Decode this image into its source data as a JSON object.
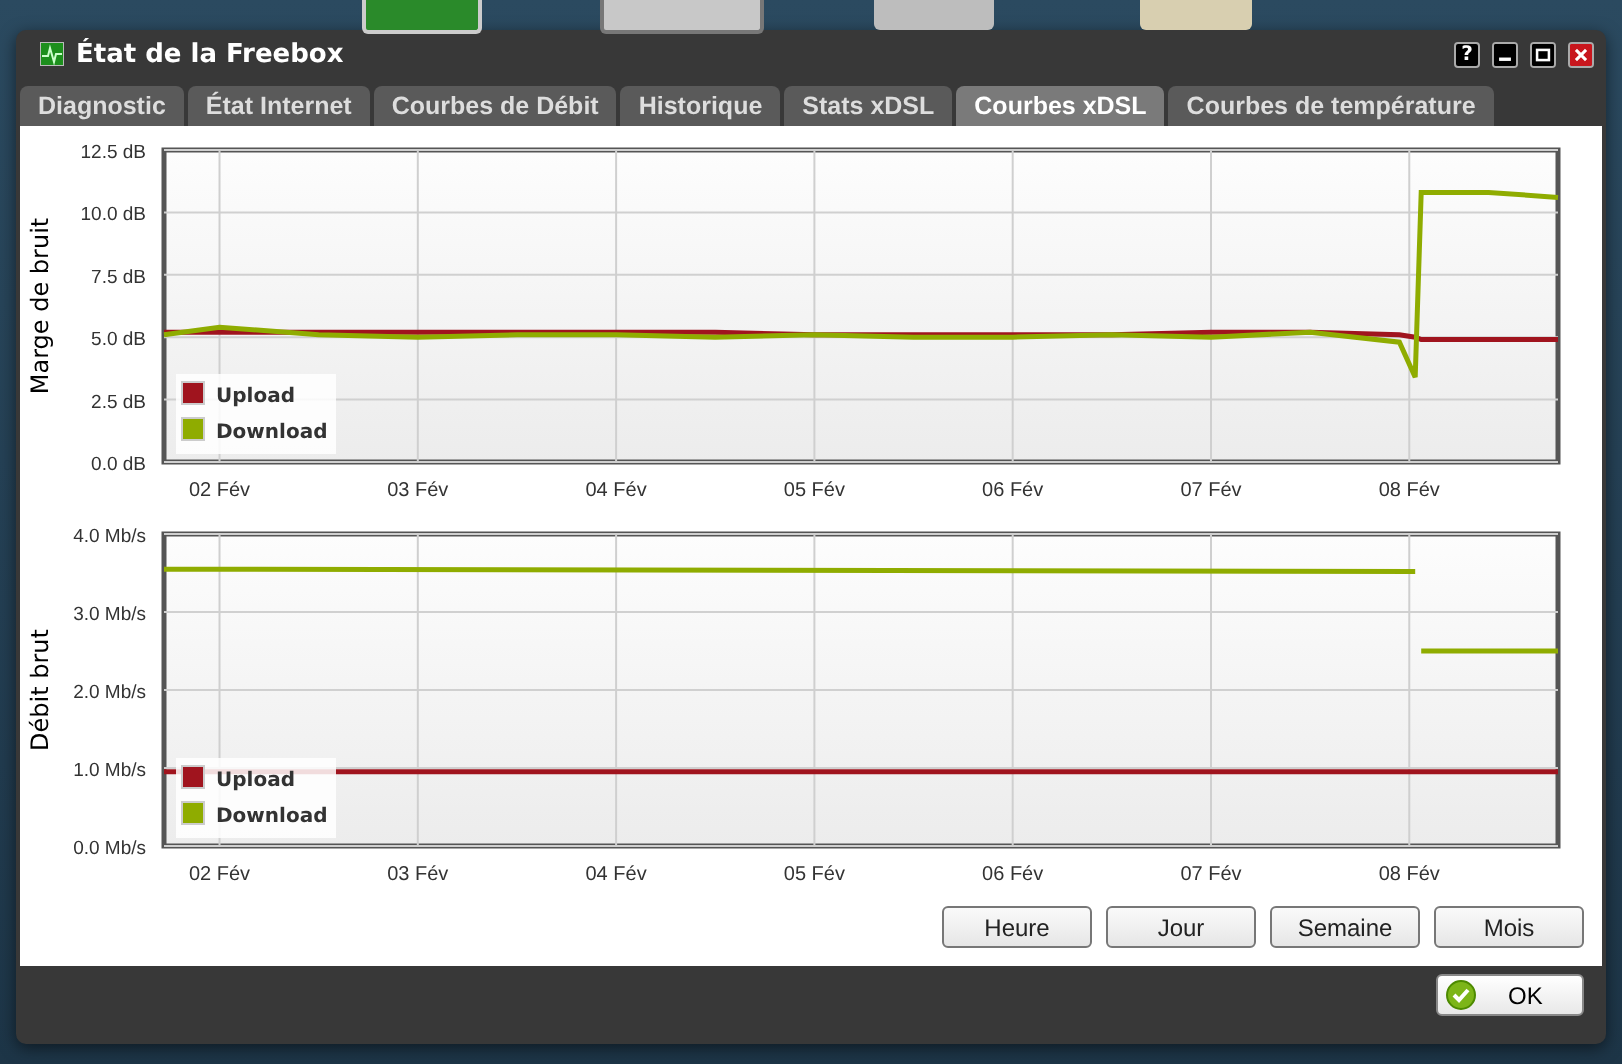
{
  "window": {
    "title": "État de la Freebox",
    "help_label": "?"
  },
  "tabs": [
    {
      "label": "Diagnostic",
      "selected": false
    },
    {
      "label": "État Internet",
      "selected": false
    },
    {
      "label": "Courbes de Débit",
      "selected": false
    },
    {
      "label": "Historique",
      "selected": false
    },
    {
      "label": "Stats xDSL",
      "selected": false
    },
    {
      "label": "Courbes xDSL",
      "selected": true
    },
    {
      "label": "Courbes de température",
      "selected": false
    }
  ],
  "charts": [
    {
      "chart_data": {
        "type": "line",
        "grid": true,
        "legend": true,
        "ylabel": "Marge de bruit",
        "x": [
          1.72,
          2,
          2.5,
          3,
          3.5,
          4,
          4.5,
          5,
          5.5,
          6,
          6.5,
          7,
          7.5,
          7.95,
          8.03,
          8.06,
          8.4,
          8.75
        ],
        "xlim": [
          1.72,
          8.75
        ],
        "ylim": [
          0,
          12.5
        ],
        "xticks": [
          {
            "value": 2,
            "label": "02 Fév"
          },
          {
            "value": 3,
            "label": "03 Fév"
          },
          {
            "value": 4,
            "label": "04 Fév"
          },
          {
            "value": 5,
            "label": "05 Fév"
          },
          {
            "value": 6,
            "label": "06 Fév"
          },
          {
            "value": 7,
            "label": "07 Fév"
          },
          {
            "value": 8,
            "label": "08 Fév"
          }
        ],
        "yticks": [
          {
            "value": 0,
            "label": "0.0 dB"
          },
          {
            "value": 2.5,
            "label": "2.5 dB"
          },
          {
            "value": 5,
            "label": "5.0 dB"
          },
          {
            "value": 7.5,
            "label": "7.5 dB"
          },
          {
            "value": 10,
            "label": "10.0 dB"
          },
          {
            "value": 12.5,
            "label": "12.5 dB"
          }
        ],
        "series": [
          {
            "name": "Upload",
            "color": "#a0141e",
            "values": [
              5.2,
              5.2,
              5.2,
              5.2,
              5.2,
              5.2,
              5.2,
              5.1,
              5.1,
              5.1,
              5.1,
              5.2,
              5.2,
              5.1,
              5.0,
              4.9,
              4.9,
              4.9
            ]
          },
          {
            "name": "Download",
            "color": "#8fac00",
            "values": [
              5.1,
              5.4,
              5.1,
              5.0,
              5.1,
              5.1,
              5.0,
              5.1,
              5.0,
              5.0,
              5.1,
              5.0,
              5.2,
              4.8,
              3.4,
              10.8,
              10.8,
              10.6
            ]
          }
        ]
      }
    },
    {
      "chart_data": {
        "type": "line",
        "grid": true,
        "legend": true,
        "ylabel": "Débit brut",
        "x": [
          1.72,
          8.03,
          8.05,
          8.06,
          8.75
        ],
        "xlim": [
          1.72,
          8.75
        ],
        "ylim": [
          0,
          4
        ],
        "xticks": [
          {
            "value": 2,
            "label": "02 Fév"
          },
          {
            "value": 3,
            "label": "03 Fév"
          },
          {
            "value": 4,
            "label": "04 Fév"
          },
          {
            "value": 5,
            "label": "05 Fév"
          },
          {
            "value": 6,
            "label": "06 Fév"
          },
          {
            "value": 7,
            "label": "07 Fév"
          },
          {
            "value": 8,
            "label": "08 Fév"
          }
        ],
        "yticks": [
          {
            "value": 0,
            "label": "0.0 Mb/s"
          },
          {
            "value": 1,
            "label": "1.0 Mb/s"
          },
          {
            "value": 2,
            "label": "2.0 Mb/s"
          },
          {
            "value": 3,
            "label": "3.0 Mb/s"
          },
          {
            "value": 4,
            "label": "4.0 Mb/s"
          }
        ],
        "series": [
          {
            "name": "Upload",
            "color": "#a0141e",
            "values": [
              0.95,
              0.95,
              0.95,
              0.95,
              0.95
            ]
          },
          {
            "name": "Download",
            "color": "#8fac00",
            "values": [
              3.55,
              3.52,
              null,
              2.5,
              2.5
            ]
          }
        ]
      }
    }
  ],
  "range_buttons": [
    {
      "label": "Heure"
    },
    {
      "label": "Jour"
    },
    {
      "label": "Semaine"
    },
    {
      "label": "Mois"
    }
  ],
  "ok_button": {
    "label": "OK"
  }
}
